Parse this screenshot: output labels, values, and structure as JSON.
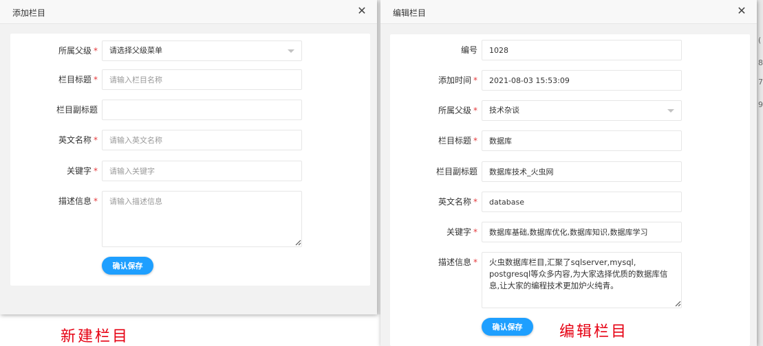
{
  "add_dialog": {
    "title": "添加栏目",
    "close_icon": "close-icon",
    "fields": {
      "parent": {
        "label": "所属父级",
        "required": true,
        "value": "请选择父级菜单"
      },
      "title": {
        "label": "栏目标题",
        "required": true,
        "placeholder": "请输入栏目名称"
      },
      "subtitle": {
        "label": "栏目副标题",
        "required": false,
        "placeholder": ""
      },
      "english_name": {
        "label": "英文名称",
        "required": true,
        "placeholder": "请输入英文名称"
      },
      "keywords": {
        "label": "关键字",
        "required": true,
        "placeholder": "请输入关键字"
      },
      "description": {
        "label": "描述信息",
        "required": true,
        "placeholder": "请输入描述信息"
      }
    },
    "save_label": "确认保存"
  },
  "edit_dialog": {
    "title": "编辑栏目",
    "close_icon": "close-icon",
    "fields": {
      "id": {
        "label": "编号",
        "required": false,
        "value": "1028"
      },
      "created_at": {
        "label": "添加时间",
        "required": true,
        "value": "2021-08-03 15:53:09"
      },
      "parent": {
        "label": "所属父级",
        "required": true,
        "value": "技术杂谈"
      },
      "title": {
        "label": "栏目标题",
        "required": true,
        "value": "数据库"
      },
      "subtitle": {
        "label": "栏目副标题",
        "required": false,
        "value": "数据库技术_火虫网"
      },
      "english_name": {
        "label": "英文名称",
        "required": true,
        "value": "database"
      },
      "keywords": {
        "label": "关键字",
        "required": true,
        "value": "数据库基础,数据库优化,数据库知识,数据库学习"
      },
      "description": {
        "label": "描述信息",
        "required": true,
        "value": "火虫数据库栏目,汇聚了sqlserver,mysql, postgresql等众多内容,为大家选择优质的数据库信息,让大家的编程技术更加炉火纯青。"
      }
    },
    "save_label": "确认保存"
  },
  "captions": {
    "add": "新建栏目",
    "edit": "编辑栏目"
  },
  "background_fragments": [
    "(",
    "8",
    "7",
    "9"
  ],
  "colors": {
    "primary_button": "#1e9fff",
    "required_mark": "#e4393c",
    "caption_red": "#e60012"
  }
}
